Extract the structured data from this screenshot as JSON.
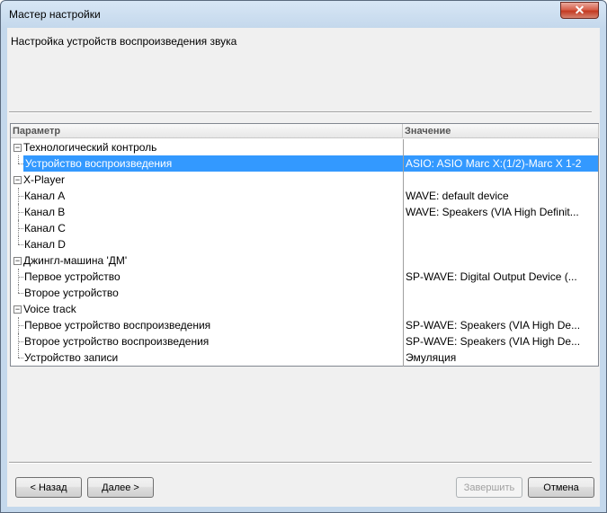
{
  "window": {
    "title": "Мастер настройки",
    "close_glyph": "✕"
  },
  "header": {
    "text": "Настройка устройств воспроизведения звука"
  },
  "grid": {
    "columns": {
      "param": "Параметр",
      "value": "Значение"
    },
    "rows": [
      {
        "name": "Технологический контроль",
        "value": "",
        "group": true,
        "expander": "−"
      },
      {
        "name": "Устройство воспроизведения",
        "value": "ASIO: ASIO Marc X:(1/2)-Marc X 1-2",
        "selected": true
      },
      {
        "name": "X-Player",
        "value": "",
        "group": true,
        "expander": "−"
      },
      {
        "name": "Канал A",
        "value": "WAVE: default device"
      },
      {
        "name": "Канал B",
        "value": "WAVE: Speakers (VIA High Definit..."
      },
      {
        "name": "Канал C",
        "value": ""
      },
      {
        "name": "Канал D",
        "value": ""
      },
      {
        "name": "Джингл-машина 'ДМ'",
        "value": "",
        "group": true,
        "expander": "−"
      },
      {
        "name": "Первое устройство",
        "value": "SP-WAVE: Digital Output Device (..."
      },
      {
        "name": "Второе устройство",
        "value": ""
      },
      {
        "name": "Voice track",
        "value": "",
        "group": true,
        "expander": "−"
      },
      {
        "name": "Первое устройство воспроизведения",
        "value": "SP-WAVE: Speakers (VIA High De..."
      },
      {
        "name": "Второе устройство воспроизведения",
        "value": "SP-WAVE: Speakers (VIA High De..."
      },
      {
        "name": "Устройство записи",
        "value": "Эмуляция"
      }
    ]
  },
  "buttons": {
    "back": "< Назад",
    "next": "Далее >",
    "finish": "Завершить",
    "cancel": "Отмена"
  }
}
